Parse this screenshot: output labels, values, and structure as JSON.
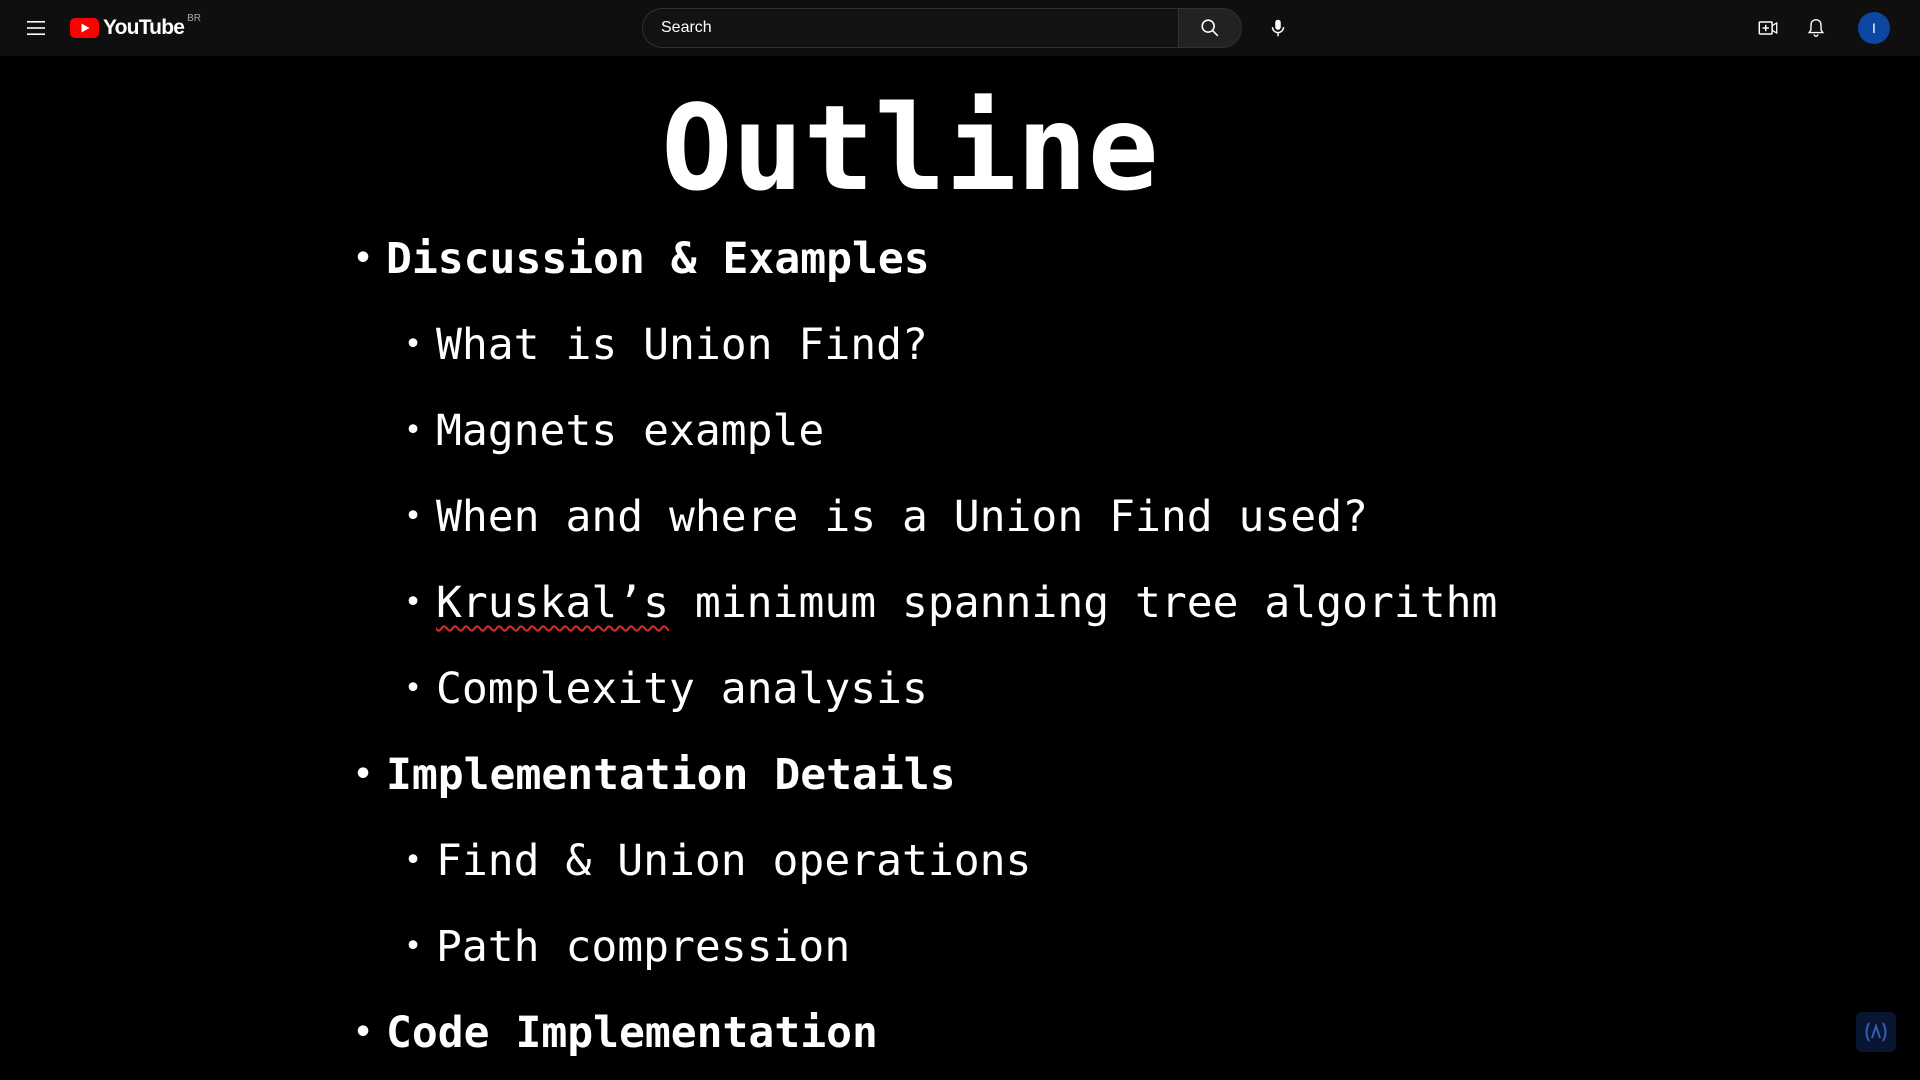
{
  "header": {
    "logo_text": "YouTube",
    "country_code": "BR",
    "search": {
      "placeholder": "Search",
      "value": "Search"
    },
    "avatar_letter": "I",
    "icons": {
      "menu": "hamburger-menu-icon",
      "search": "search-icon",
      "mic": "microphone-icon",
      "create": "create-video-icon",
      "notifications": "bell-icon"
    },
    "colors": {
      "bar_bg": "#0f0f0f",
      "logo_red": "#ff0000",
      "avatar_bg": "#0d47a1"
    }
  },
  "slide": {
    "title": "Outline",
    "items": [
      {
        "level": 1,
        "text": "Discussion & Examples"
      },
      {
        "level": 2,
        "text": "What is Union Find?"
      },
      {
        "level": 2,
        "text": "Magnets example"
      },
      {
        "level": 2,
        "text": "When and where is a Union Find used?"
      },
      {
        "level": 2,
        "text_underlined": "Kruskal’s",
        "text_rest": " minimum spanning tree algorithm"
      },
      {
        "level": 2,
        "text": "Complexity analysis"
      },
      {
        "level": 1,
        "text": "Implementation Details"
      },
      {
        "level": 2,
        "text": "Find & Union operations"
      },
      {
        "level": 2,
        "text": "Path compression"
      },
      {
        "level": 1,
        "text": "Code Implementation"
      }
    ]
  }
}
